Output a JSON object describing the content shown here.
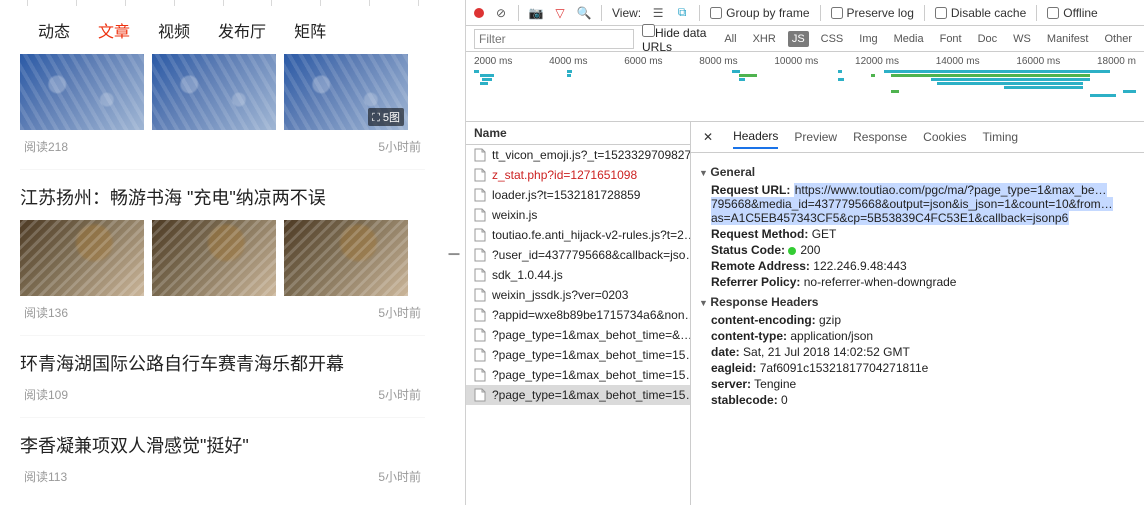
{
  "tabs": {
    "items": [
      "动态",
      "文章",
      "视频",
      "发布厅",
      "矩阵"
    ],
    "active_index": 1
  },
  "feed": [
    {
      "badge": "⛶ 5图",
      "reads_label": "阅读218",
      "time": "5小时前",
      "has_images": true
    },
    {
      "title": "江苏扬州：畅游书海 \"充电\"纳凉两不误",
      "reads_label": "阅读136",
      "time": "5小时前",
      "has_images": true
    },
    {
      "title": "环青海湖国际公路自行车赛青海乐都开幕",
      "reads_label": "阅读109",
      "time": "5小时前",
      "has_images": false
    },
    {
      "title": "李香凝兼项双人滑感觉\"挺好\"",
      "reads_label": "阅读113",
      "time": "5小时前",
      "has_images": false
    }
  ],
  "devtools": {
    "toolbar": {
      "view_label": "View:",
      "group_by_frame": "Group by frame",
      "preserve_log": "Preserve log",
      "disable_cache": "Disable cache",
      "offline": "Offline"
    },
    "filter_placeholder": "Filter",
    "hide_data_urls": "Hide data URLs",
    "types": [
      "All",
      "XHR",
      "JS",
      "CSS",
      "Img",
      "Media",
      "Font",
      "Doc",
      "WS",
      "Manifest",
      "Other"
    ],
    "active_type_index": 2,
    "time_ticks": [
      "2000 ms",
      "4000 ms",
      "6000 ms",
      "8000 ms",
      "10000 ms",
      "12000 ms",
      "14000 ms",
      "16000 ms",
      "18000 m"
    ],
    "name_header": "Name",
    "requests": [
      {
        "label": "tt_vicon_emoji.js?_t=1523329709827"
      },
      {
        "label": "z_stat.php?id=1271651098",
        "red": true
      },
      {
        "label": "loader.js?t=1532181728859"
      },
      {
        "label": "weixin.js"
      },
      {
        "label": "toutiao.fe.anti_hijack-v2-rules.js?t=2…"
      },
      {
        "label": "?user_id=4377795668&callback=jso…"
      },
      {
        "label": "sdk_1.0.44.js"
      },
      {
        "label": "weixin_jssdk.js?ver=0203"
      },
      {
        "label": "?appid=wxe8b89be1715734a6&non…"
      },
      {
        "label": "?page_type=1&max_behot_time=&…"
      },
      {
        "label": "?page_type=1&max_behot_time=15…"
      },
      {
        "label": "?page_type=1&max_behot_time=15…"
      },
      {
        "label": "?page_type=1&max_behot_time=15…"
      }
    ],
    "selected_request_index": 12,
    "detail_tabs": [
      "Headers",
      "Preview",
      "Response",
      "Cookies",
      "Timing"
    ],
    "active_detail_tab": 0,
    "general": {
      "header": "General",
      "request_url_k": "Request URL:",
      "request_url_v": "https://www.toutiao.com/pgc/ma/?page_type=1&max_be…795668&media_id=4377795668&output=json&is_json=1&count=10&from…as=A1C5EB457343CF5&cp=5B53839C4FC53E1&callback=jsonp6",
      "method_k": "Request Method:",
      "method_v": "GET",
      "status_k": "Status Code:",
      "status_v": "200",
      "remote_k": "Remote Address:",
      "remote_v": "122.246.9.48:443",
      "referrer_k": "Referrer Policy:",
      "referrer_v": "no-referrer-when-downgrade"
    },
    "response_headers": {
      "header": "Response Headers",
      "items": [
        {
          "k": "content-encoding:",
          "v": "gzip"
        },
        {
          "k": "content-type:",
          "v": "application/json"
        },
        {
          "k": "date:",
          "v": "Sat, 21 Jul 2018 14:02:52 GMT"
        },
        {
          "k": "eagleid:",
          "v": "7af6091c15321817704271811e"
        },
        {
          "k": "server:",
          "v": "Tengine"
        },
        {
          "k": "stablecode:",
          "v": "0"
        }
      ]
    }
  }
}
